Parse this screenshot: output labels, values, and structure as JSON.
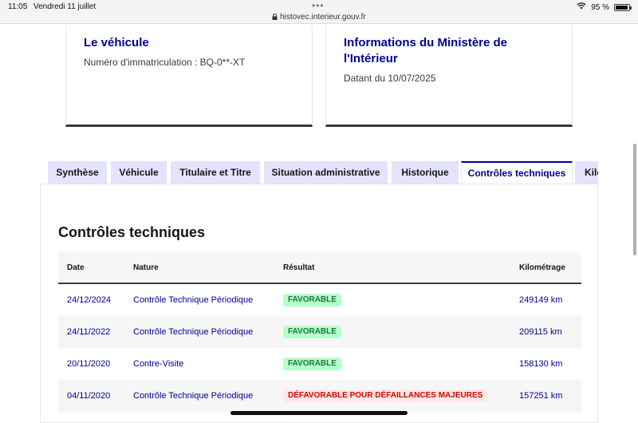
{
  "statusbar": {
    "time": "11:05",
    "date": "Vendredi 11 juillet",
    "url": "histovec.interieur.gouv.fr",
    "battery": "95 %",
    "battery_level": 0.95
  },
  "cards": {
    "vehicle": {
      "title": "Le véhicule",
      "subtitle": "Numéro d'immatriculation : BQ-0**-XT"
    },
    "ministry": {
      "title": "Informations du Ministère de l'Intérieur",
      "subtitle": "Datant du 10/07/2025"
    }
  },
  "tabs": [
    {
      "label": "Synthèse"
    },
    {
      "label": "Véhicule"
    },
    {
      "label": "Titulaire et Titre"
    },
    {
      "label": "Situation administrative"
    },
    {
      "label": "Historique"
    },
    {
      "label": "Contrôles techniques",
      "active": true
    },
    {
      "label": "Kilo"
    }
  ],
  "section": {
    "title": "Contrôles techniques"
  },
  "table": {
    "headers": {
      "date": "Date",
      "nature": "Nature",
      "result": "Résultat",
      "km": "Kilométrage"
    },
    "rows": [
      {
        "date": "24/12/2024",
        "nature": "Contrôle Technique Périodique",
        "result": "FAVORABLE",
        "status": "ok",
        "km": "249149 km"
      },
      {
        "date": "24/11/2022",
        "nature": "Contrôle Technique Périodique",
        "result": "FAVORABLE",
        "status": "ok",
        "km": "209115 km"
      },
      {
        "date": "20/11/2020",
        "nature": "Contre-Visite",
        "result": "FAVORABLE",
        "status": "ok",
        "km": "158130 km"
      },
      {
        "date": "04/11/2020",
        "nature": "Contrôle Technique Périodique",
        "result": "DÉFAVORABLE POUR DÉFAILLANCES MAJEURES",
        "status": "ko",
        "km": "157251 km"
      }
    ]
  },
  "colors": {
    "primary": "#000091",
    "tab_bg": "#e3e3fd",
    "success_bg": "#b8fec9",
    "success_text": "#18753c",
    "error_bg": "#ffe9e6",
    "error_text": "#ce0500"
  }
}
